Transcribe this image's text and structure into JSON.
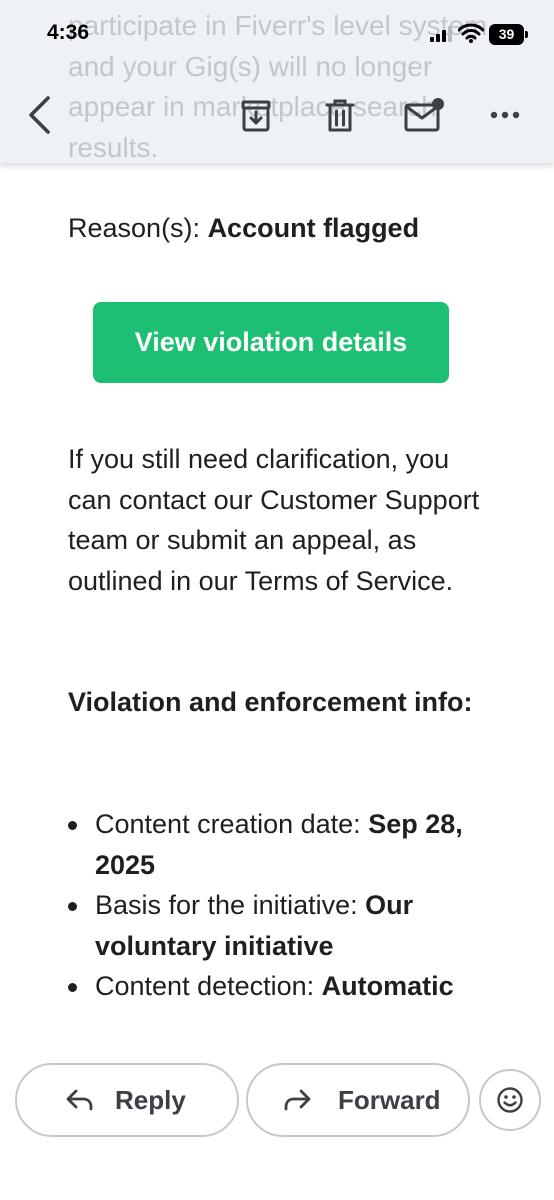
{
  "status_bar": {
    "time": "4:36",
    "battery": "39"
  },
  "underlay_text": "participate in Fiverr's level system, and your Gig(s) will no longer appear in marketplace search results.",
  "toolbar": {
    "back_icon": "chevron-left-icon",
    "archive_icon": "archive-icon",
    "delete_icon": "trash-icon",
    "unread_icon": "mail-unread-icon",
    "more_icon": "more-horizontal-icon"
  },
  "email": {
    "reason_label": "Reason(s): ",
    "reason_value": "Account flagged",
    "cta_label": "View violation details",
    "cta_color": "#1dbf73",
    "clarification_paragraph": "If you still need clarification, you can contact our Customer Support team or submit an appeal, as outlined in our Terms of Service.",
    "section_heading": "Violation and enforcement info:",
    "bullets": [
      {
        "label": "Content creation date: ",
        "value": "Sep 28, 2025"
      },
      {
        "label": "Basis for the initiative: ",
        "value": "Our voluntary initiative"
      },
      {
        "label": "Content detection: ",
        "value": "Automatic"
      }
    ]
  },
  "actions": {
    "reply_label": "Reply",
    "forward_label": "Forward",
    "reply_icon": "reply-icon",
    "forward_icon": "forward-icon",
    "emoji_icon": "emoji-smile-icon"
  }
}
